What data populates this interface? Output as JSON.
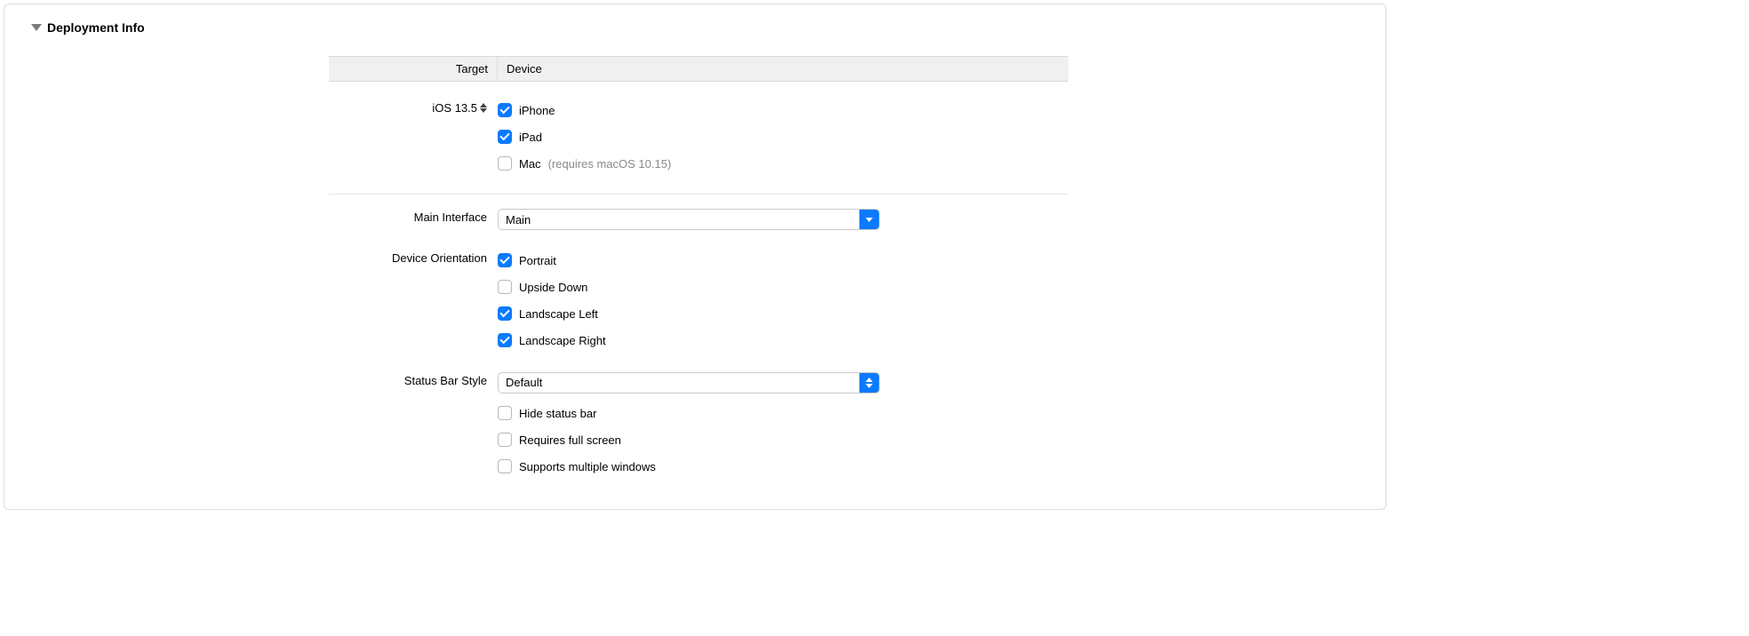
{
  "section": {
    "title": "Deployment Info"
  },
  "table_head": {
    "target": "Target",
    "device": "Device"
  },
  "target": {
    "version": "iOS 13.5",
    "devices": [
      {
        "label": "iPhone",
        "checked": true
      },
      {
        "label": "iPad",
        "checked": true
      },
      {
        "label": "Mac",
        "checked": false,
        "note": "(requires macOS 10.15)"
      }
    ]
  },
  "main_interface": {
    "label": "Main Interface",
    "value": "Main"
  },
  "orientation": {
    "label": "Device Orientation",
    "options": [
      {
        "label": "Portrait",
        "checked": true
      },
      {
        "label": "Upside Down",
        "checked": false
      },
      {
        "label": "Landscape Left",
        "checked": true
      },
      {
        "label": "Landscape Right",
        "checked": true
      }
    ]
  },
  "status_bar": {
    "label": "Status Bar Style",
    "value": "Default",
    "options": [
      {
        "label": "Hide status bar",
        "checked": false
      },
      {
        "label": "Requires full screen",
        "checked": false
      },
      {
        "label": "Supports multiple windows",
        "checked": false
      }
    ]
  }
}
